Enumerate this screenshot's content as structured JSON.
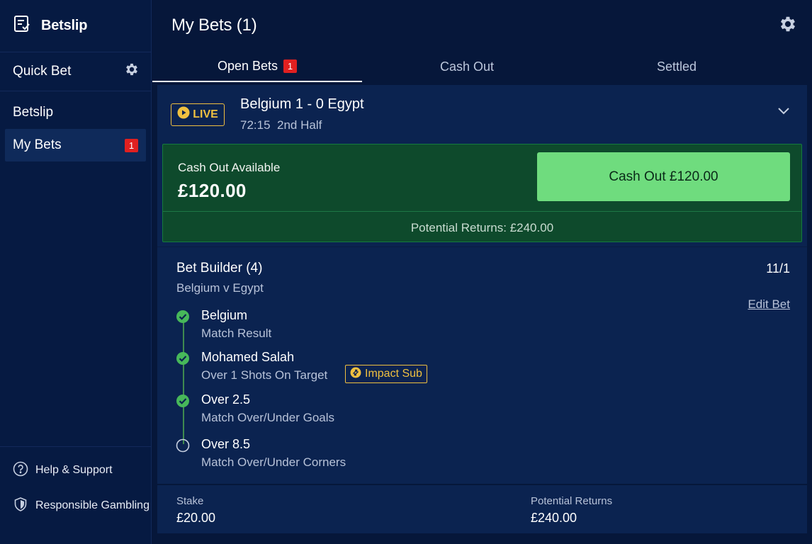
{
  "sidebar": {
    "title": "Betslip",
    "quick_bet": "Quick Bet",
    "items": [
      {
        "label": "Betslip"
      },
      {
        "label": "My Bets",
        "badge": "1"
      }
    ],
    "footer": [
      {
        "label": "Help & Support",
        "icon": "help-icon"
      },
      {
        "label": "Responsible Gambling",
        "icon": "shield-icon"
      }
    ]
  },
  "header": {
    "title": "My Bets (1)"
  },
  "tabs": [
    {
      "label": "Open Bets",
      "badge": "1",
      "active": true
    },
    {
      "label": "Cash Out"
    },
    {
      "label": "Settled"
    }
  ],
  "match": {
    "live_label": "LIVE",
    "title": "Belgium 1 - 0 Egypt",
    "time": "72:15",
    "period": "2nd Half"
  },
  "cashout": {
    "label": "Cash Out Available",
    "amount": "£120.00",
    "button": "Cash Out £120.00",
    "potential": "Potential Returns: £240.00"
  },
  "bet_builder": {
    "title": "Bet Builder (4)",
    "subtitle": "Belgium v Egypt",
    "odds": "11/1",
    "edit": "Edit Bet",
    "legs": [
      {
        "name": "Belgium",
        "desc": "Match Result",
        "status": "won"
      },
      {
        "name": "Mohamed Salah",
        "desc": "Over 1 Shots On Target",
        "status": "won",
        "tag": "Impact Sub"
      },
      {
        "name": "Over 2.5",
        "desc": "Match Over/Under Goals",
        "status": "won"
      },
      {
        "name": "Over 8.5",
        "desc": "Match Over/Under Corners",
        "status": "pending"
      }
    ]
  },
  "stake": {
    "stake_label": "Stake",
    "stake_value": "£20.00",
    "returns_label": "Potential Returns",
    "returns_value": "£240.00"
  },
  "colors": {
    "background": "#06173a",
    "card": "#0b2350",
    "cashout_bg": "#0e4a2c",
    "cashout_button": "#6fdc7e",
    "badge": "#e02020",
    "live": "#f0c040",
    "check": "#47b85a"
  }
}
